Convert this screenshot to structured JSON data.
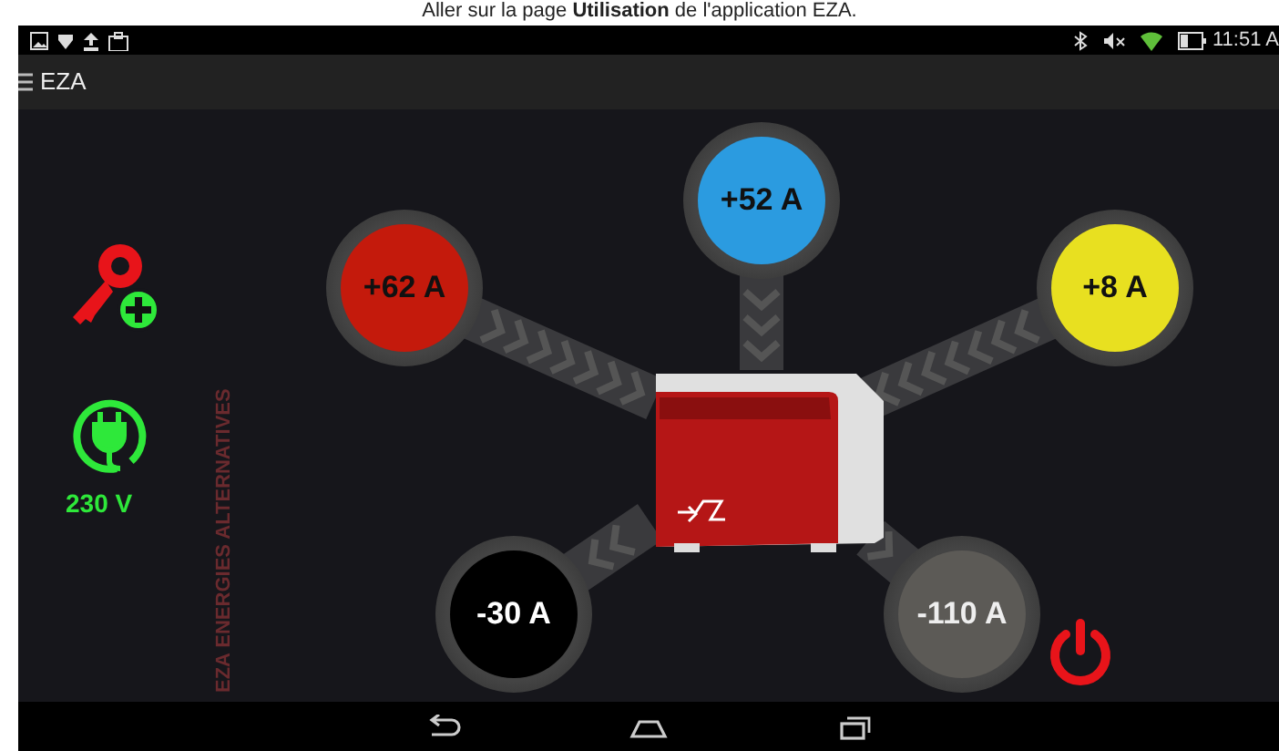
{
  "caption": "Aller sur la page **Utilisation** de l'application EZA.",
  "status_bar": {
    "time": "11:51 A"
  },
  "app_bar": {
    "title": "EZA"
  },
  "side_panel": {
    "voltage": "230 V",
    "watermark": "EZA ENERGIES ALTERNATIVES"
  },
  "flows": [
    {
      "value": "+62 A",
      "color": "#c41a0c",
      "kind": "inflow",
      "power_button": false
    },
    {
      "value": "+52 A",
      "color": "#2b9be0",
      "kind": "inflow",
      "power_button": false
    },
    {
      "value": "+8 A",
      "color": "#e8e020",
      "kind": "inflow",
      "power_button": false
    },
    {
      "value": "-30 A",
      "color": "#000000",
      "kind": "outflow",
      "power_button": false
    },
    {
      "value": "-110 A",
      "color": "#5c5a56",
      "kind": "outflow",
      "power_button": true
    }
  ]
}
